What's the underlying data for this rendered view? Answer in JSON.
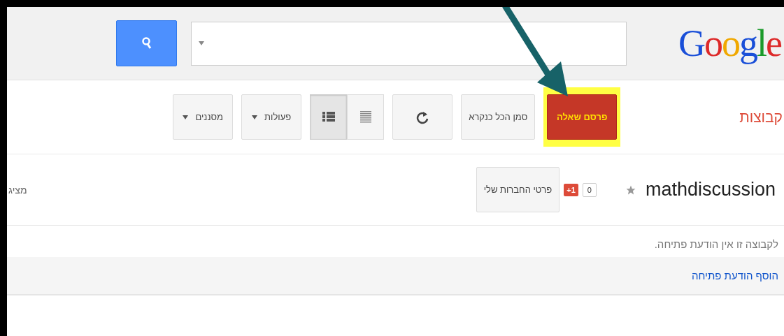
{
  "header": {
    "logo": "Google"
  },
  "toolbar": {
    "title": "קבוצות",
    "buttons": [
      {
        "kind": "primary",
        "label": "פרסם שאלה",
        "highlighted": true
      },
      {
        "kind": "plain",
        "label": "סמן הכל כנקרא"
      },
      {
        "kind": "refresh"
      },
      {
        "kind": "view-toggle",
        "options": [
          {
            "kind": "compact",
            "selected": false
          },
          {
            "kind": "list",
            "selected": true
          }
        ]
      },
      {
        "kind": "menu",
        "label": "פעולות"
      },
      {
        "kind": "menu",
        "label": "מסננים"
      }
    ]
  },
  "group": {
    "name": "mathdiscussion",
    "starred": false,
    "plus_one_count": "0",
    "plus_one_label": "+1",
    "membership_button": "פרטי החברות שלי",
    "showing": "מציג"
  },
  "welcome": {
    "message": "לקבוצה זו אין הודעת פתיחה.",
    "add_link": "הוסף הודעת פתיחה"
  }
}
